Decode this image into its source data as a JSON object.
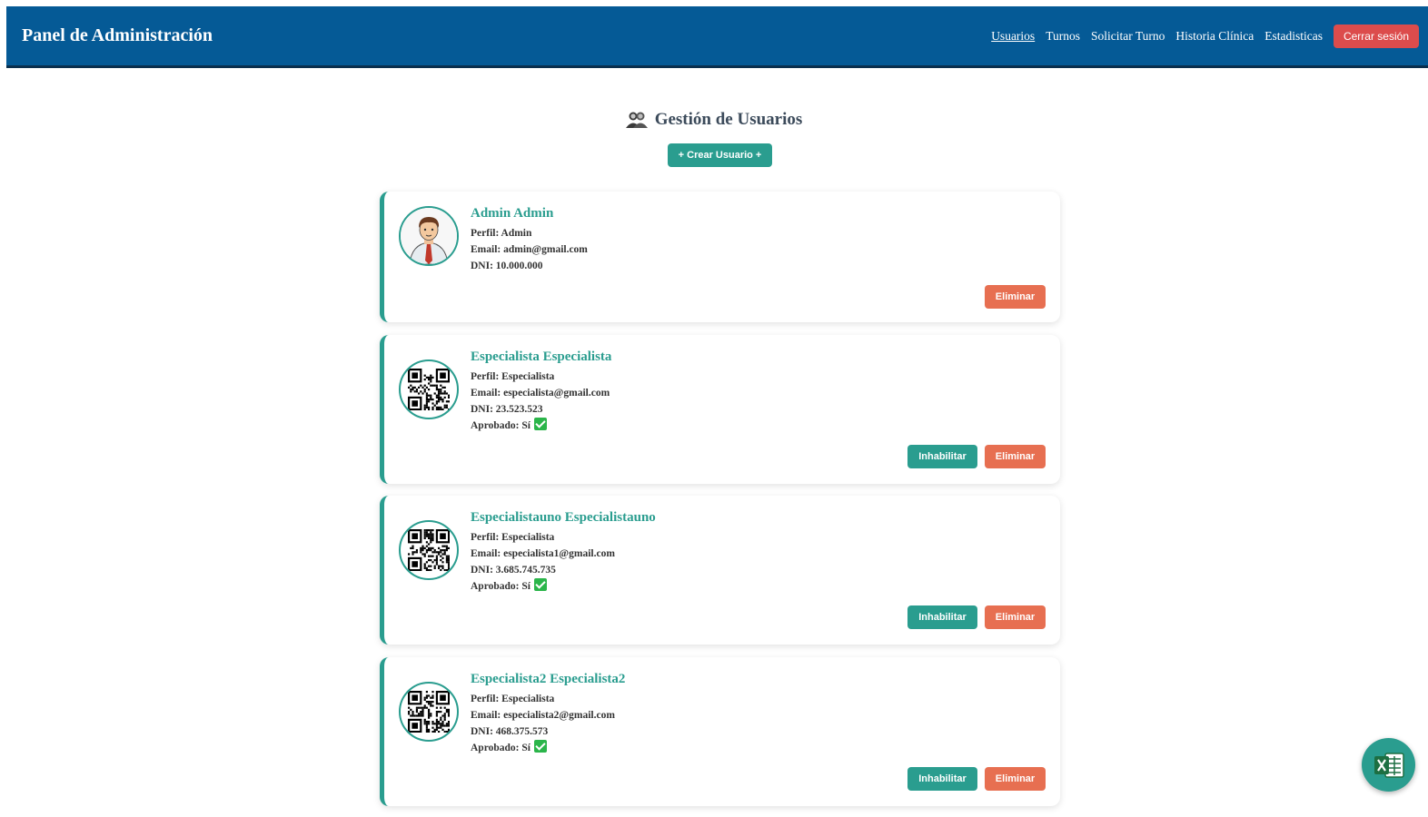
{
  "nav": {
    "brand": "Panel de Administración",
    "links": [
      "Usuarios",
      "Turnos",
      "Solicitar Turno",
      "Historia Clínica",
      "Estadisticas"
    ],
    "logout": "Cerrar sesión"
  },
  "page": {
    "title": "Gestión de Usuarios",
    "create_button": "+ Crear Usuario +"
  },
  "users": [
    {
      "name": "Admin Admin",
      "profile": "Perfil: Admin",
      "email": "Email: admin@gmail.com",
      "dni": "DNI: 10.000.000",
      "avatar": "admin-avatar",
      "delete_label": "Eliminar"
    },
    {
      "name": "Especialista Especialista",
      "profile": "Perfil: Especialista",
      "email": "Email: especialista@gmail.com",
      "dni": "DNI: 23.523.523",
      "approved": "Aprobado: Sí",
      "avatar": "qr-code",
      "disable_label": "Inhabilitar",
      "delete_label": "Eliminar"
    },
    {
      "name": "Especialistauno Especialistauno",
      "profile": "Perfil: Especialista",
      "email": "Email: especialista1@gmail.com",
      "dni": "DNI: 3.685.745.735",
      "approved": "Aprobado: Sí",
      "avatar": "qr-code",
      "disable_label": "Inhabilitar",
      "delete_label": "Eliminar"
    },
    {
      "name": "Especialista2 Especialista2",
      "profile": "Perfil: Especialista",
      "email": "Email: especialista2@gmail.com",
      "dni": "DNI: 468.375.573",
      "approved": "Aprobado: Sí",
      "avatar": "qr-code",
      "disable_label": "Inhabilitar",
      "delete_label": "Eliminar"
    }
  ],
  "colors": {
    "navbar": "#055a96",
    "accent": "#2a9d8f",
    "danger": "#e76f51",
    "logout": "#dc4c4c"
  },
  "fab": {
    "icon": "excel-icon"
  }
}
